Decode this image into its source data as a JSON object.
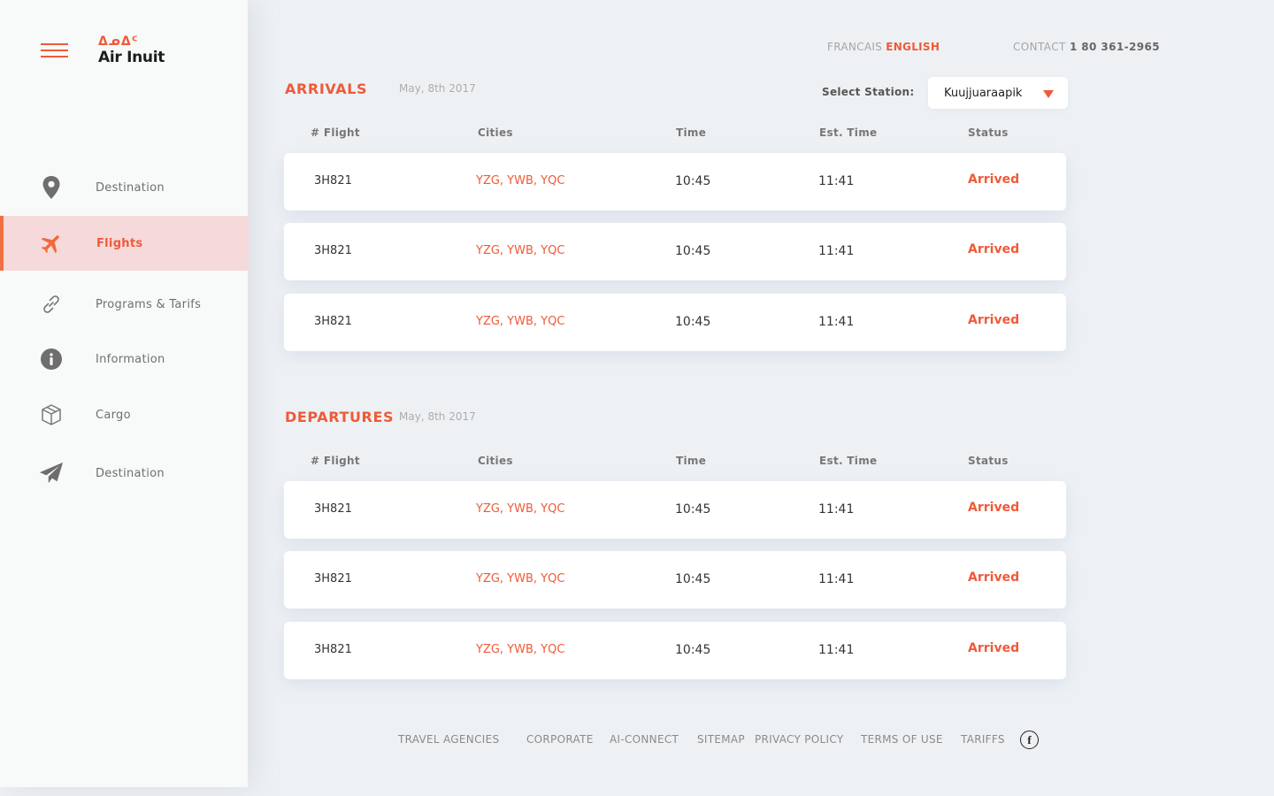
{
  "brand": {
    "logo_glyph": "ᐃᓄᐃᑦ",
    "name": "Air Inuit",
    "accent": "#ef5a38"
  },
  "sidebar": {
    "items": [
      {
        "label": "Destination",
        "icon": "map-pin-icon"
      },
      {
        "label": "Flights",
        "icon": "airplane-icon",
        "active": true
      },
      {
        "label": "Programs & Tarifs",
        "icon": "link-icon"
      },
      {
        "label": "Information",
        "icon": "info-icon"
      },
      {
        "label": "Cargo",
        "icon": "box-icon"
      },
      {
        "label": "Destination",
        "icon": "paper-plane-icon"
      }
    ]
  },
  "header": {
    "lang_fr": "FRANCAIS",
    "lang_en": "ENGLISH",
    "contact_label": "CONTACT",
    "contact_phone": "1 80 361-2965"
  },
  "station": {
    "label": "Select Station:",
    "value": "Kuujjuaraapik"
  },
  "columns": {
    "flight": "# Flight",
    "cities": "Cities",
    "time": "Time",
    "est_time": "Est. Time",
    "status": "Status"
  },
  "arrivals": {
    "title": "ARRIVALS",
    "date": "May, 8th 2017",
    "rows": [
      {
        "flight": "3H821",
        "cities": "YZG, YWB, YQC",
        "time": "10:45",
        "est": "11:41",
        "status": "Arrived"
      },
      {
        "flight": "3H821",
        "cities": "YZG, YWB, YQC",
        "time": "10:45",
        "est": "11:41",
        "status": "Arrived"
      },
      {
        "flight": "3H821",
        "cities": "YZG, YWB, YQC",
        "time": "10:45",
        "est": "11:41",
        "status": "Arrived"
      }
    ]
  },
  "departures": {
    "title": "DEPARTURES",
    "date": "May, 8th 2017",
    "rows": [
      {
        "flight": "3H821",
        "cities": "YZG, YWB, YQC",
        "time": "10:45",
        "est": "11:41",
        "status": "Arrived"
      },
      {
        "flight": "3H821",
        "cities": "YZG, YWB, YQC",
        "time": "10:45",
        "est": "11:41",
        "status": "Arrived"
      },
      {
        "flight": "3H821",
        "cities": "YZG, YWB, YQC",
        "time": "10:45",
        "est": "11:41",
        "status": "Arrived"
      }
    ]
  },
  "footer": {
    "links": [
      "TRAVEL AGENCIES",
      "CORPORATE",
      "AI-CONNECT",
      "SITEMAP",
      "PRIVACY POLICY",
      "TERMS OF USE",
      "TARIFFS"
    ],
    "facebook_glyph": "f"
  }
}
